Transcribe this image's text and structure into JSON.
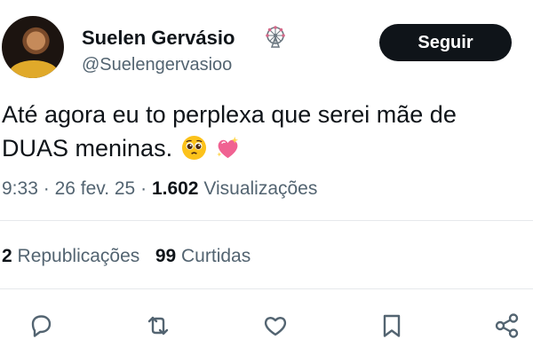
{
  "author": {
    "display_name": "Suelen Gervásio",
    "handle": "@Suelengervasioo",
    "badge_icon": "ferris-wheel-icon"
  },
  "follow_button": {
    "label": "Seguir"
  },
  "tweet": {
    "line1": "Até agora eu to perplexa que serei mãe de",
    "line2": "DUAS meninas.",
    "emojis": [
      "pleading-face-emoji",
      "sparkling-heart-emoji"
    ]
  },
  "meta": {
    "time": "9:33",
    "separator": "·",
    "date": "26 fev. 25",
    "views_count": "1.602",
    "views_label": "Visualizações"
  },
  "stats": {
    "reposts_count": "2",
    "reposts_label": "Republicações",
    "likes_count": "99",
    "likes_label": "Curtidas"
  },
  "actions": [
    "reply-icon",
    "repost-icon",
    "like-icon",
    "bookmark-icon",
    "share-icon"
  ],
  "colors": {
    "text": "#0f1419",
    "secondary": "#536471",
    "button_bg": "#0f1419",
    "divider": "#e6e9ec"
  }
}
